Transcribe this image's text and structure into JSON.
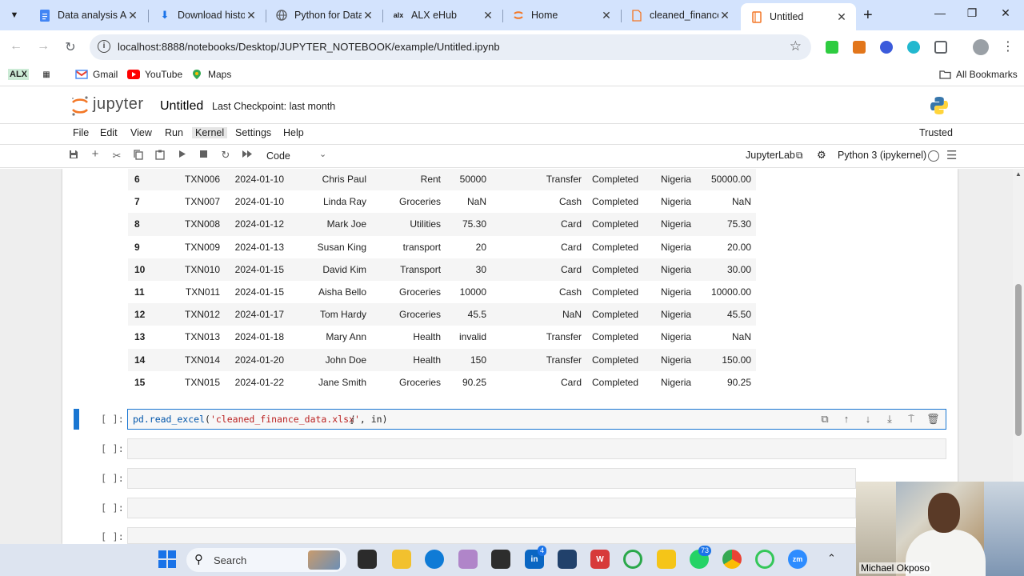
{
  "browser": {
    "tabs": [
      {
        "title": "Data analysis Ab",
        "icon": "docs-icon",
        "color": "#4285f4"
      },
      {
        "title": "Download histor",
        "icon": "download-icon",
        "color": "#1a73e8"
      },
      {
        "title": "Python for Data",
        "icon": "globe-icon",
        "color": "#5f6368"
      },
      {
        "title": "ALX eHub",
        "icon": "alx-icon",
        "color": "#1f1f1f"
      },
      {
        "title": "Home",
        "icon": "jupyter-icon",
        "color": "#f37726"
      },
      {
        "title": "cleaned_finance",
        "icon": "file-icon",
        "color": "#f37726"
      },
      {
        "title": "Untitled",
        "icon": "notebook-icon",
        "color": "#f37726"
      }
    ],
    "url": "localhost:8888/notebooks/Desktop/JUPYTER_NOTEBOOK/example/Untitled.ipynb",
    "bookmarks": [
      {
        "label": "ALX"
      },
      {
        "label": "Gmail"
      },
      {
        "label": "YouTube"
      },
      {
        "label": "Maps"
      }
    ],
    "all_bookmarks": "All Bookmarks"
  },
  "jupyter": {
    "logo_text": "jupyter",
    "notebook_title": "Untitled",
    "checkpoint": "Last Checkpoint: last month",
    "menu": [
      "File",
      "Edit",
      "View",
      "Run",
      "Kernel",
      "Settings",
      "Help"
    ],
    "active_menu": "Kernel",
    "trusted": "Trusted",
    "cell_type": "Code",
    "jupyterlab_link": "JupyterLab",
    "kernel_name": "Python 3 (ipykernel)",
    "accent": "#1976d2"
  },
  "dataframe": {
    "rows": [
      [
        "6",
        "TXN006",
        "2024-01-10",
        "Chris Paul",
        "Rent",
        "50000",
        "Transfer",
        "Completed",
        "Nigeria",
        "50000.00"
      ],
      [
        "7",
        "TXN007",
        "2024-01-10",
        "Linda Ray",
        "Groceries",
        "NaN",
        "Cash",
        "Completed",
        "Nigeria",
        "NaN"
      ],
      [
        "8",
        "TXN008",
        "2024-01-12",
        "Mark Joe",
        "Utilities",
        "75.30",
        "Card",
        "Completed",
        "Nigeria",
        "75.30"
      ],
      [
        "9",
        "TXN009",
        "2024-01-13",
        "Susan King",
        "transport",
        "20",
        "Card",
        "Completed",
        "Nigeria",
        "20.00"
      ],
      [
        "10",
        "TXN010",
        "2024-01-15",
        "David Kim",
        "Transport",
        "30",
        "Card",
        "Completed",
        "Nigeria",
        "30.00"
      ],
      [
        "11",
        "TXN011",
        "2024-01-15",
        "Aisha Bello",
        "Groceries",
        "10000",
        "Cash",
        "Completed",
        "Nigeria",
        "10000.00"
      ],
      [
        "12",
        "TXN012",
        "2024-01-17",
        "Tom Hardy",
        "Groceries",
        "45.5",
        "NaN",
        "Completed",
        "Nigeria",
        "45.50"
      ],
      [
        "13",
        "TXN013",
        "2024-01-18",
        "Mary Ann",
        "Health",
        "invalid",
        "Transfer",
        "Completed",
        "Nigeria",
        "NaN"
      ],
      [
        "14",
        "TXN014",
        "2024-01-20",
        "John Doe",
        "Health",
        "150",
        "Transfer",
        "Completed",
        "Nigeria",
        "150.00"
      ],
      [
        "15",
        "TXN015",
        "2024-01-22",
        "Jane Smith",
        "Groceries",
        "90.25",
        "Card",
        "Completed",
        "Nigeria",
        "90.25"
      ]
    ]
  },
  "cells": [
    {
      "prompt": "[ ]:",
      "code_fn": "pd.read_excel",
      "code_open": "(",
      "code_str": "'cleaned_finance_data.xlsx'",
      "code_rest": ", in)",
      "active": true
    },
    {
      "prompt": "[ ]:",
      "active": false
    },
    {
      "prompt": "[ ]:",
      "active": false
    },
    {
      "prompt": "[ ]:",
      "active": false
    },
    {
      "prompt": "[ ]:",
      "active": false
    }
  ],
  "webcam": {
    "name": "Michael Okposo"
  },
  "taskbar": {
    "search_label": "Search",
    "badges": {
      "linkedin": "4",
      "whatsapp": "73"
    }
  }
}
